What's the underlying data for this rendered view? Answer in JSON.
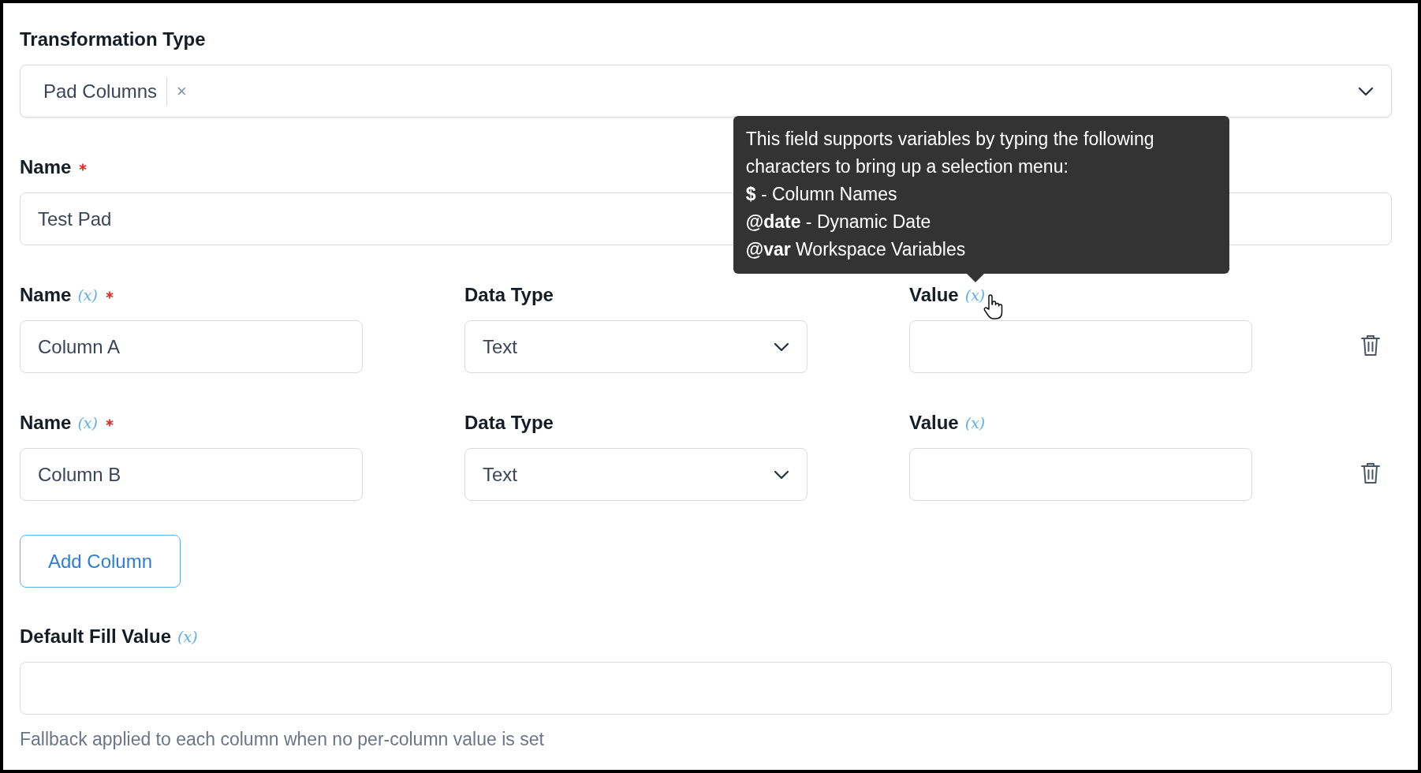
{
  "transformation_type": {
    "label": "Transformation Type",
    "tag": "Pad Columns",
    "remove": "×"
  },
  "name": {
    "label": "Name",
    "required": true,
    "value": "Test Pad"
  },
  "columns": [
    {
      "name_label": "Name",
      "name_variable": "(x)",
      "required": true,
      "name_value": "Column A",
      "type_label": "Data Type",
      "type_value": "Text",
      "value_label": "Value",
      "value_variable": "(x)",
      "tooltip": {
        "lines": [
          "This field supports variables by typing the following",
          "characters to bring up a selection menu:",
          "**$** - Column Names",
          "**@date** - Dynamic Date",
          "**@var** Workspace Variables"
        ]
      }
    },
    {
      "name_label": "Name",
      "name_variable": "(x)",
      "required": true,
      "name_value": "Column B",
      "type_label": "Data Type",
      "type_value": "Text",
      "value_label": "Value",
      "value_variable": "(x)"
    }
  ],
  "add_button": "Add Column",
  "default_fill": {
    "label": "Default Fill Value",
    "variable": "(x)",
    "help": "Fallback applied to each column when no per-column value is set"
  }
}
